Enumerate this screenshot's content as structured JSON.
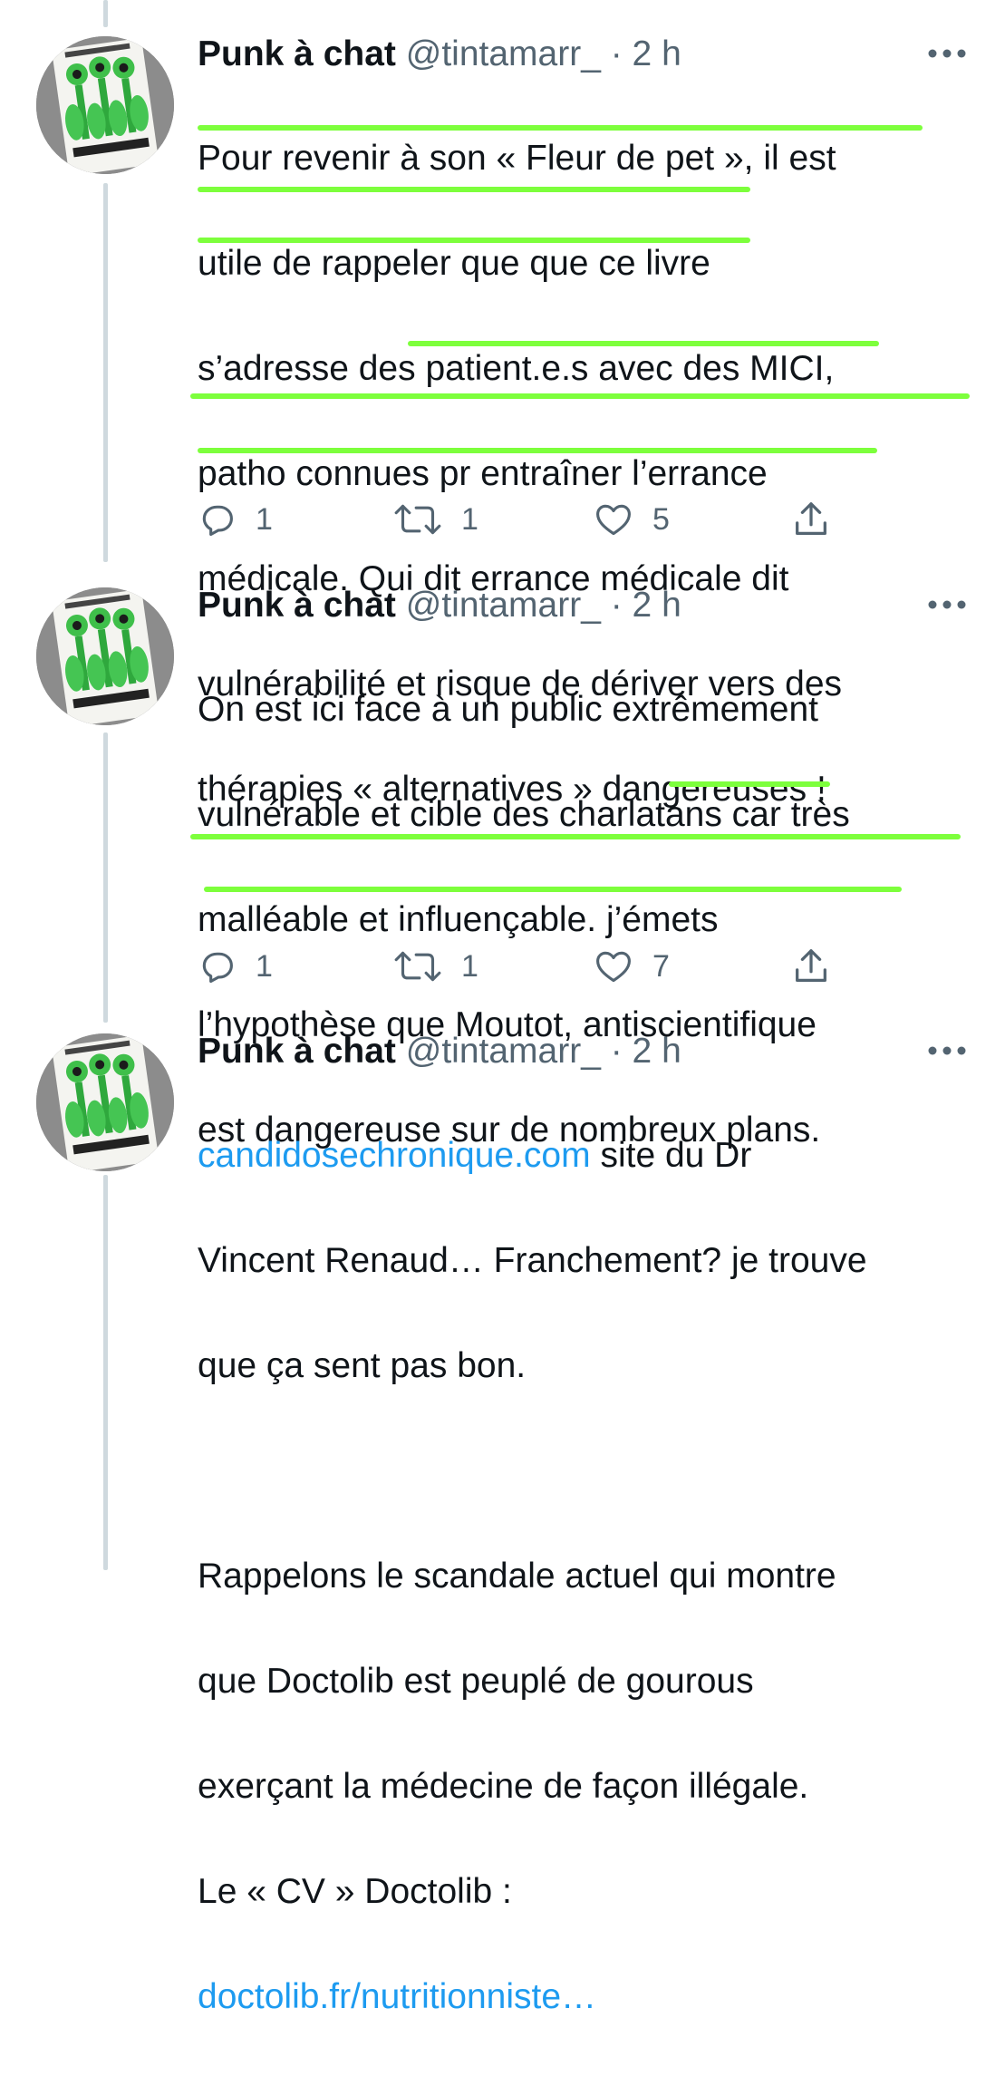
{
  "colors": {
    "highlight": "#7dff3c",
    "link": "#1d9bf0",
    "secondary": "#536471",
    "text": "#0f1419"
  },
  "tweets": [
    {
      "name": "Punk à chat",
      "handle": "@tintamarr_ · 2 h",
      "lines": [
        "Pour revenir à son « Fleur de pet », il est",
        "utile de rappeler que que ce livre",
        "s’adresse des patient.e.s avec des MICI,",
        "patho connues pr entraîner l’errance",
        "médicale. Qui dit errance médicale dit",
        "vulnérabilité et risque de dériver vers des",
        "thérapies « alternatives » dangereuses !"
      ],
      "actions": {
        "reply_icon": "reply-icon",
        "reply_count": "1",
        "retweet_icon": "retweet-icon",
        "retweet_count": "1",
        "like_icon": "heart-icon",
        "like_count": "5",
        "share_icon": "share-icon"
      }
    },
    {
      "name": "Punk à chat",
      "handle": "@tintamarr_ · 2 h",
      "lines": [
        "On est ici face à un public extrêmement",
        "vulnérable et cible des charlatans car très",
        "malléable et influençable. j’émets",
        "l’hypothèse que Moutot, antiscientifique",
        "est dangereuse sur de nombreux plans."
      ],
      "actions": {
        "reply_icon": "reply-icon",
        "reply_count": "1",
        "retweet_icon": "retweet-icon",
        "retweet_count": "1",
        "like_icon": "heart-icon",
        "like_count": "7",
        "share_icon": "share-icon"
      }
    },
    {
      "name": "Punk à chat",
      "handle": "@tintamarr_ · 2 h",
      "link1": "candidosechronique.com",
      "after_link1": " site du Dr",
      "lines": [
        "Vincent Renaud… Franchement? je trouve",
        "que ça sent pas bon.",
        "",
        "Rappelons le scandale actuel qui montre",
        "que Doctolib est peuplé de gourous",
        "exerçant la médecine de façon illégale.",
        "Le « CV » Doctolib :"
      ],
      "link2": "doctolib.fr/nutritionniste…"
    }
  ]
}
